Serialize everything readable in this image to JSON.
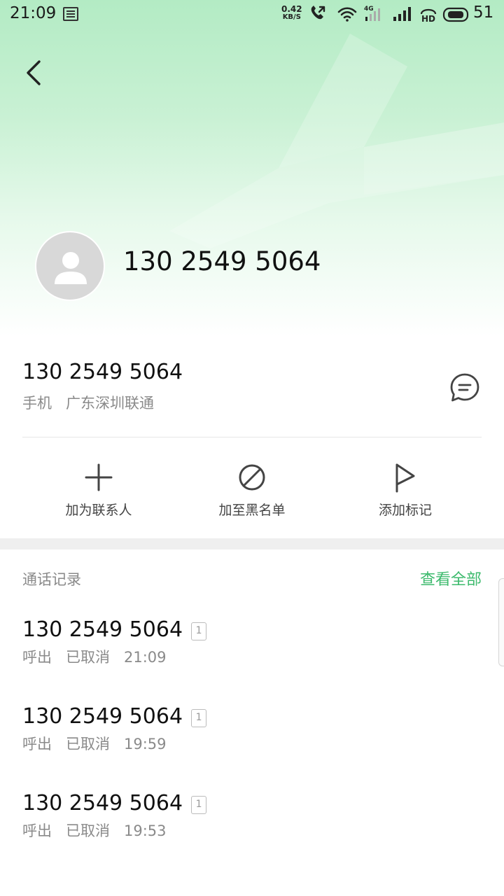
{
  "status_bar": {
    "time": "21:09",
    "speed_value": "0.42",
    "speed_unit": "KB/S",
    "network": "4G",
    "battery": "51"
  },
  "contact": {
    "title": "130 2549 5064"
  },
  "number_info": {
    "number": "130 2549 5064",
    "type": "手机",
    "location": "广东深圳联通"
  },
  "actions": [
    {
      "label": "加为联系人",
      "icon": "plus-icon"
    },
    {
      "label": "加至黑名单",
      "icon": "block-icon"
    },
    {
      "label": "添加标记",
      "icon": "flag-icon"
    }
  ],
  "call_log": {
    "title": "通话记录",
    "view_all": "查看全部",
    "items": [
      {
        "number": "130 2549 5064",
        "sim": "1",
        "direction": "呼出",
        "status": "已取消",
        "time": "21:09"
      },
      {
        "number": "130 2549 5064",
        "sim": "1",
        "direction": "呼出",
        "status": "已取消",
        "time": "19:59"
      },
      {
        "number": "130 2549 5064",
        "sim": "1",
        "direction": "呼出",
        "status": "已取消",
        "time": "19:53"
      }
    ]
  },
  "colors": {
    "accent": "#3dba6d",
    "header_top": "#b3ebc4"
  }
}
